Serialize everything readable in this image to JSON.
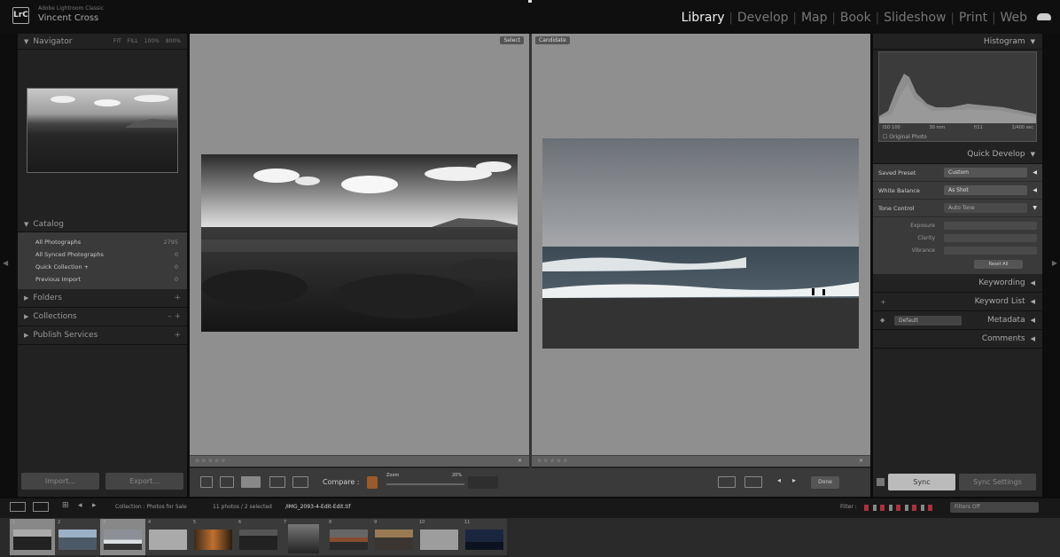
{
  "app": {
    "subtitle": "Adobe Lightroom Classic",
    "user": "Vincent Cross",
    "logo_text": "LrC",
    "modules": [
      "Library",
      "Develop",
      "Map",
      "Book",
      "Slideshow",
      "Print",
      "Web"
    ],
    "active_module": "Library",
    "cloud_icon": "cloud-icon"
  },
  "left_panel": {
    "navigator": {
      "label": "Navigator",
      "zoom_levels": [
        "FIT",
        "FILL",
        "100%",
        "800%"
      ]
    },
    "catalog": {
      "label": "Catalog",
      "items": [
        {
          "label": "All Photographs",
          "count": "2795"
        },
        {
          "label": "All Synced Photographs",
          "count": "0"
        },
        {
          "label": "Quick Collection +",
          "count": "0"
        },
        {
          "label": "Previous Import",
          "count": "0"
        }
      ]
    },
    "folders": {
      "label": "Folders"
    },
    "collections": {
      "label": "Collections"
    },
    "publish": {
      "label": "Publish Services"
    },
    "import_label": "Import...",
    "export_label": "Export..."
  },
  "center": {
    "select_tag": "Select",
    "candidate_tag": "Candidate",
    "compare_label": "Compare :",
    "zoom_label": "Zoom",
    "zoom_value": "20%",
    "done_label": "Done"
  },
  "right_panel": {
    "histogram": {
      "label": "Histogram",
      "values": [
        "ISO 100",
        "30 mm",
        "f/11",
        "1/400 sec"
      ],
      "original_photo": "Original Photo"
    },
    "quick_develop": {
      "label": "Quick Develop",
      "saved_preset_label": "Saved Preset",
      "saved_preset_value": "Custom",
      "white_balance_label": "White Balance",
      "white_balance_value": "As Shot",
      "tone_control_label": "Tone Control",
      "auto_tone": "Auto Tone",
      "exposure_label": "Exposure",
      "clarity_label": "Clarity",
      "vibrance_label": "Vibrance",
      "reset_all": "Reset All"
    },
    "keywording": "Keywording",
    "keyword_list": "Keyword List",
    "metadata": "Metadata",
    "metadata_preset": "Default",
    "comments": "Comments",
    "sync_label": "Sync",
    "sync_settings_label": "Sync Settings"
  },
  "filmstrip": {
    "collection_label": "Collection : Photos for Sale",
    "count_label": "11 photos / 2 selected",
    "filename": "/IMG_2093-4-Edit-Edit.tif",
    "filter_label": "Filter :",
    "filters_off": "Filters Off",
    "thumb_numbers": [
      "1",
      "2",
      "3",
      "4",
      "5",
      "6",
      "7",
      "8",
      "9",
      "10",
      "11"
    ]
  },
  "colors": {
    "accent": "#f0f0f0",
    "panel": "#222222",
    "pane": "#8f8f8f"
  }
}
